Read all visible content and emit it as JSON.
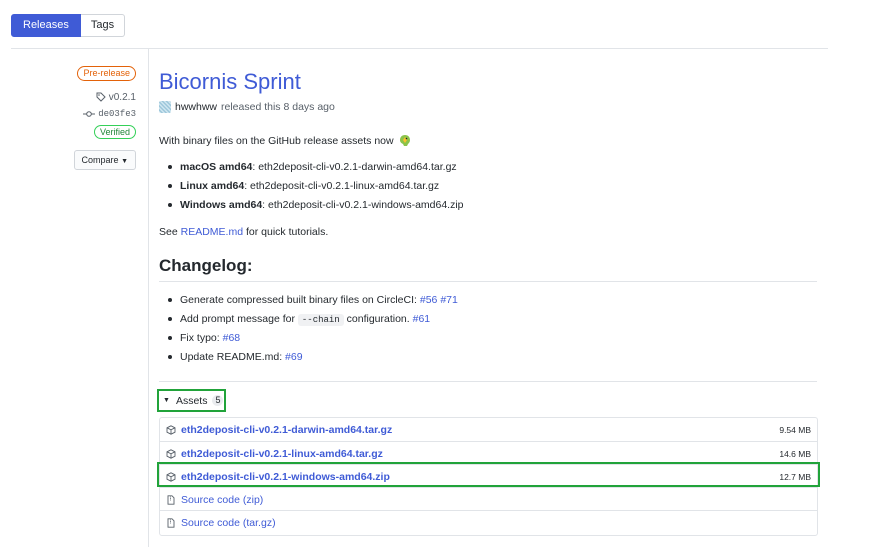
{
  "tabs": [
    {
      "label": "Releases",
      "active": true
    },
    {
      "label": "Tags",
      "active": false
    }
  ],
  "meta": {
    "prerelease": "Pre-release",
    "tag": "v0.2.1",
    "commit": "de03fe3",
    "verified": "Verified",
    "compare": "Compare"
  },
  "release": {
    "title": "Bicornis Sprint",
    "author": "hwwhww",
    "released_text": "released this 8 days ago",
    "intro": "With binary files on the GitHub release assets now",
    "binaries": [
      {
        "os": "macOS amd64",
        "file": "eth2deposit-cli-v0.2.1-darwin-amd64.tar.gz"
      },
      {
        "os": "Linux amd64",
        "file": "eth2deposit-cli-v0.2.1-linux-amd64.tar.gz"
      },
      {
        "os": "Windows amd64",
        "file": "eth2deposit-cli-v0.2.1-windows-amd64.zip"
      }
    ],
    "see_prefix": "See",
    "readme_link": "README.md",
    "see_suffix": "for quick tutorials.",
    "changelog_heading": "Changelog:",
    "changelog": {
      "item1_text": "Generate compressed built binary files on CircleCI:",
      "item1_links": [
        "#56",
        "#71"
      ],
      "item2_pre": "Add prompt message for",
      "item2_code": "--chain",
      "item2_post": "configuration.",
      "item2_link": "#61",
      "item3_text": "Fix typo:",
      "item3_link": "#68",
      "item4_text": "Update README.md:",
      "item4_link": "#69"
    }
  },
  "assets": {
    "label": "Assets",
    "count": "5",
    "files": [
      {
        "name": "eth2deposit-cli-v0.2.1-darwin-amd64.tar.gz",
        "size": "9.54 MB"
      },
      {
        "name": "eth2deposit-cli-v0.2.1-linux-amd64.tar.gz",
        "size": "14.6 MB"
      },
      {
        "name": "eth2deposit-cli-v0.2.1-windows-amd64.zip",
        "size": "12.7 MB"
      }
    ],
    "sources": [
      {
        "label": "Source code",
        "fmt": "(zip)"
      },
      {
        "label": "Source code",
        "fmt": "(tar.gz)"
      }
    ]
  },
  "colors": {
    "accent": "#3f5bd6",
    "highlight": "#21a33a",
    "prerelease": "#e36209"
  }
}
